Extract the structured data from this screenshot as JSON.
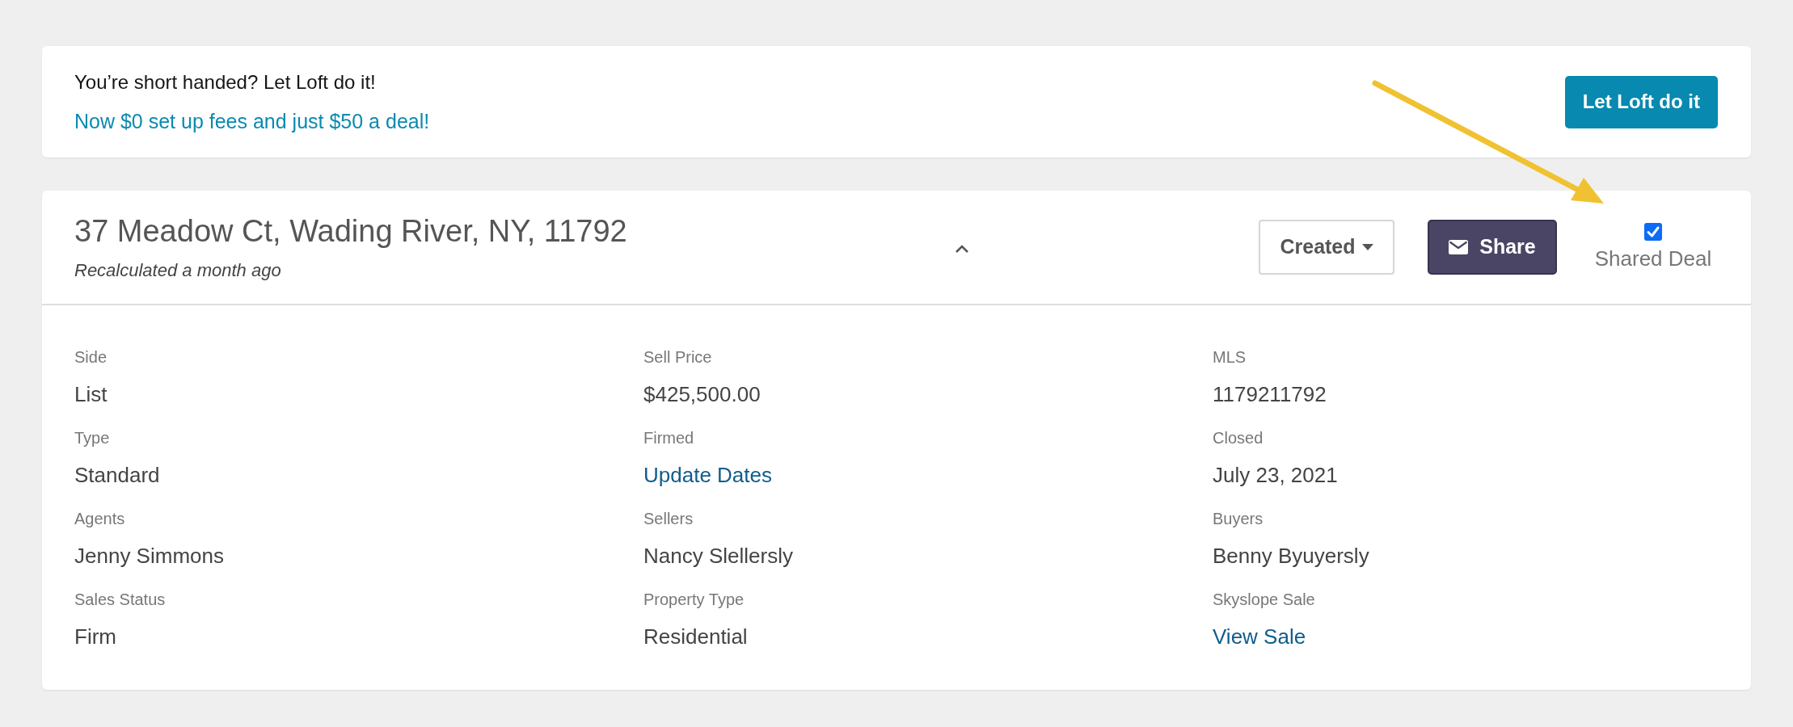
{
  "promo_banner": {
    "title": "You’re short handed? Let Loft do it!",
    "subtitle": "Now $0 set up fees and just $50 a deal!",
    "button": "Let Loft do it"
  },
  "deal": {
    "address": "37 Meadow Ct, Wading River, NY, 11792",
    "recalculated": "Recalculated a month ago",
    "expanded": true,
    "status_dropdown": {
      "label": "Created"
    },
    "share_button": {
      "label": "Share"
    },
    "shared_deal": {
      "label": "Shared Deal",
      "checked": true
    },
    "fields": [
      {
        "label": "Side",
        "value": "List",
        "kind": "text"
      },
      {
        "label": "Sell Price",
        "value": "$425,500.00",
        "kind": "text"
      },
      {
        "label": "MLS",
        "value": "1179211792",
        "kind": "text"
      },
      {
        "label": "Type",
        "value": "Standard",
        "kind": "text"
      },
      {
        "label": "Firmed",
        "value": "Update Dates",
        "kind": "link"
      },
      {
        "label": "Closed",
        "value": "July 23, 2021",
        "kind": "text"
      },
      {
        "label": "Agents",
        "value": "Jenny Simmons",
        "kind": "text"
      },
      {
        "label": "Sellers",
        "value": "Nancy Slellersly",
        "kind": "text"
      },
      {
        "label": "Buyers",
        "value": "Benny Byuyersly",
        "kind": "text"
      },
      {
        "label": "Sales Status",
        "value": "Firm",
        "kind": "text"
      },
      {
        "label": "Property Type",
        "value": "Residential",
        "kind": "text"
      },
      {
        "label": "Skyslope Sale",
        "value": "View Sale",
        "kind": "link"
      }
    ]
  }
}
